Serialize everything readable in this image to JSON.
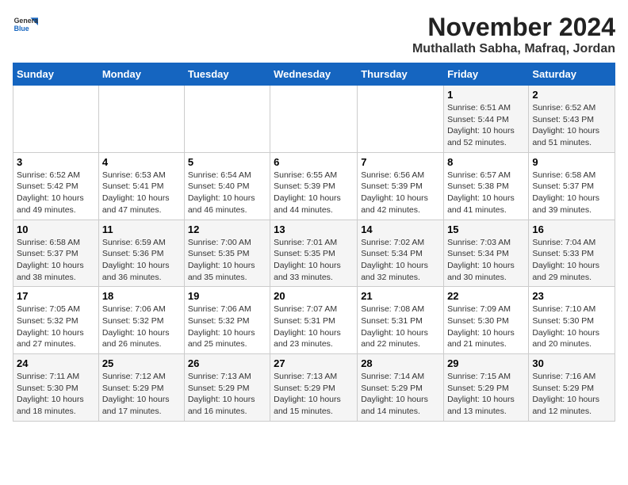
{
  "header": {
    "logo_general": "General",
    "logo_blue": "Blue",
    "month_title": "November 2024",
    "location": "Muthallath Sabha, Mafraq, Jordan"
  },
  "weekdays": [
    "Sunday",
    "Monday",
    "Tuesday",
    "Wednesday",
    "Thursday",
    "Friday",
    "Saturday"
  ],
  "weeks": [
    [
      {
        "day": "",
        "info": ""
      },
      {
        "day": "",
        "info": ""
      },
      {
        "day": "",
        "info": ""
      },
      {
        "day": "",
        "info": ""
      },
      {
        "day": "",
        "info": ""
      },
      {
        "day": "1",
        "info": "Sunrise: 6:51 AM\nSunset: 5:44 PM\nDaylight: 10 hours and 52 minutes."
      },
      {
        "day": "2",
        "info": "Sunrise: 6:52 AM\nSunset: 5:43 PM\nDaylight: 10 hours and 51 minutes."
      }
    ],
    [
      {
        "day": "3",
        "info": "Sunrise: 6:52 AM\nSunset: 5:42 PM\nDaylight: 10 hours and 49 minutes."
      },
      {
        "day": "4",
        "info": "Sunrise: 6:53 AM\nSunset: 5:41 PM\nDaylight: 10 hours and 47 minutes."
      },
      {
        "day": "5",
        "info": "Sunrise: 6:54 AM\nSunset: 5:40 PM\nDaylight: 10 hours and 46 minutes."
      },
      {
        "day": "6",
        "info": "Sunrise: 6:55 AM\nSunset: 5:39 PM\nDaylight: 10 hours and 44 minutes."
      },
      {
        "day": "7",
        "info": "Sunrise: 6:56 AM\nSunset: 5:39 PM\nDaylight: 10 hours and 42 minutes."
      },
      {
        "day": "8",
        "info": "Sunrise: 6:57 AM\nSunset: 5:38 PM\nDaylight: 10 hours and 41 minutes."
      },
      {
        "day": "9",
        "info": "Sunrise: 6:58 AM\nSunset: 5:37 PM\nDaylight: 10 hours and 39 minutes."
      }
    ],
    [
      {
        "day": "10",
        "info": "Sunrise: 6:58 AM\nSunset: 5:37 PM\nDaylight: 10 hours and 38 minutes."
      },
      {
        "day": "11",
        "info": "Sunrise: 6:59 AM\nSunset: 5:36 PM\nDaylight: 10 hours and 36 minutes."
      },
      {
        "day": "12",
        "info": "Sunrise: 7:00 AM\nSunset: 5:35 PM\nDaylight: 10 hours and 35 minutes."
      },
      {
        "day": "13",
        "info": "Sunrise: 7:01 AM\nSunset: 5:35 PM\nDaylight: 10 hours and 33 minutes."
      },
      {
        "day": "14",
        "info": "Sunrise: 7:02 AM\nSunset: 5:34 PM\nDaylight: 10 hours and 32 minutes."
      },
      {
        "day": "15",
        "info": "Sunrise: 7:03 AM\nSunset: 5:34 PM\nDaylight: 10 hours and 30 minutes."
      },
      {
        "day": "16",
        "info": "Sunrise: 7:04 AM\nSunset: 5:33 PM\nDaylight: 10 hours and 29 minutes."
      }
    ],
    [
      {
        "day": "17",
        "info": "Sunrise: 7:05 AM\nSunset: 5:32 PM\nDaylight: 10 hours and 27 minutes."
      },
      {
        "day": "18",
        "info": "Sunrise: 7:06 AM\nSunset: 5:32 PM\nDaylight: 10 hours and 26 minutes."
      },
      {
        "day": "19",
        "info": "Sunrise: 7:06 AM\nSunset: 5:32 PM\nDaylight: 10 hours and 25 minutes."
      },
      {
        "day": "20",
        "info": "Sunrise: 7:07 AM\nSunset: 5:31 PM\nDaylight: 10 hours and 23 minutes."
      },
      {
        "day": "21",
        "info": "Sunrise: 7:08 AM\nSunset: 5:31 PM\nDaylight: 10 hours and 22 minutes."
      },
      {
        "day": "22",
        "info": "Sunrise: 7:09 AM\nSunset: 5:30 PM\nDaylight: 10 hours and 21 minutes."
      },
      {
        "day": "23",
        "info": "Sunrise: 7:10 AM\nSunset: 5:30 PM\nDaylight: 10 hours and 20 minutes."
      }
    ],
    [
      {
        "day": "24",
        "info": "Sunrise: 7:11 AM\nSunset: 5:30 PM\nDaylight: 10 hours and 18 minutes."
      },
      {
        "day": "25",
        "info": "Sunrise: 7:12 AM\nSunset: 5:29 PM\nDaylight: 10 hours and 17 minutes."
      },
      {
        "day": "26",
        "info": "Sunrise: 7:13 AM\nSunset: 5:29 PM\nDaylight: 10 hours and 16 minutes."
      },
      {
        "day": "27",
        "info": "Sunrise: 7:13 AM\nSunset: 5:29 PM\nDaylight: 10 hours and 15 minutes."
      },
      {
        "day": "28",
        "info": "Sunrise: 7:14 AM\nSunset: 5:29 PM\nDaylight: 10 hours and 14 minutes."
      },
      {
        "day": "29",
        "info": "Sunrise: 7:15 AM\nSunset: 5:29 PM\nDaylight: 10 hours and 13 minutes."
      },
      {
        "day": "30",
        "info": "Sunrise: 7:16 AM\nSunset: 5:29 PM\nDaylight: 10 hours and 12 minutes."
      }
    ]
  ]
}
